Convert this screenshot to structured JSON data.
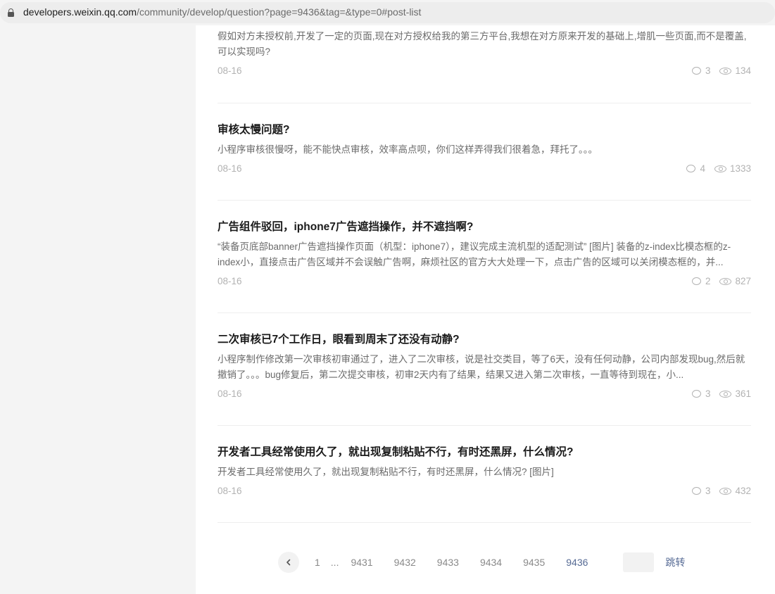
{
  "browser": {
    "url_host": "developers.weixin.qq.com",
    "url_path": "/community/develop/question?page=9436&tag=&type=0#post-list"
  },
  "posts": [
    {
      "title": "",
      "excerpt": "假如对方未授权前,开发了一定的页面,现在对方授权给我的第三方平台,我想在对方原来开发的基础上,增肌一些页面,而不是覆盖,可以实现吗?",
      "date": "08-16",
      "comments": "3",
      "views": "134"
    },
    {
      "title": "审核太慢问题?",
      "excerpt": "小程序审核很慢呀，能不能快点审核，效率高点呗，你们这样弄得我们很着急，拜托了。。。",
      "date": "08-16",
      "comments": "4",
      "views": "1333"
    },
    {
      "title": "广告组件驳回，iphone7广告遮挡操作，并不遮挡啊?",
      "excerpt": "“装备页底部banner广告遮挡操作页面（机型：iphone7），建议完成主流机型的适配测试” [图片] 装备的z-index比模态框的z-index小，直接点击广告区域并不会误触广告啊，麻烦社区的官方大大处理一下，点击广告的区域可以关闭模态框的，并...",
      "date": "08-16",
      "comments": "2",
      "views": "827"
    },
    {
      "title": "二次审核已7个工作日，眼看到周末了还没有动静?",
      "excerpt": "小程序制作修改第一次审核初审通过了，进入了二次审核，说是社交类目，等了6天，没有任何动静，公司内部发现bug,然后就撤销了。。。bug修复后，第二次提交审核，初审2天内有了结果，结果又进入第二次审核，一直等待到现在，小...",
      "date": "08-16",
      "comments": "3",
      "views": "361"
    },
    {
      "title": "开发者工具经常使用久了，就出现复制粘贴不行，有时还黑屏，什么情况?",
      "excerpt": "开发者工具经常使用久了，就出现复制粘贴不行，有时还黑屏，什么情况? [图片]",
      "date": "08-16",
      "comments": "3",
      "views": "432"
    }
  ],
  "pagination": {
    "prev_icon": "chevron-left-icon",
    "first": "1",
    "ellipsis": "...",
    "pages": [
      "9431",
      "9432",
      "9433",
      "9434",
      "9435"
    ],
    "current": "9436",
    "jump_label": "跳转"
  }
}
